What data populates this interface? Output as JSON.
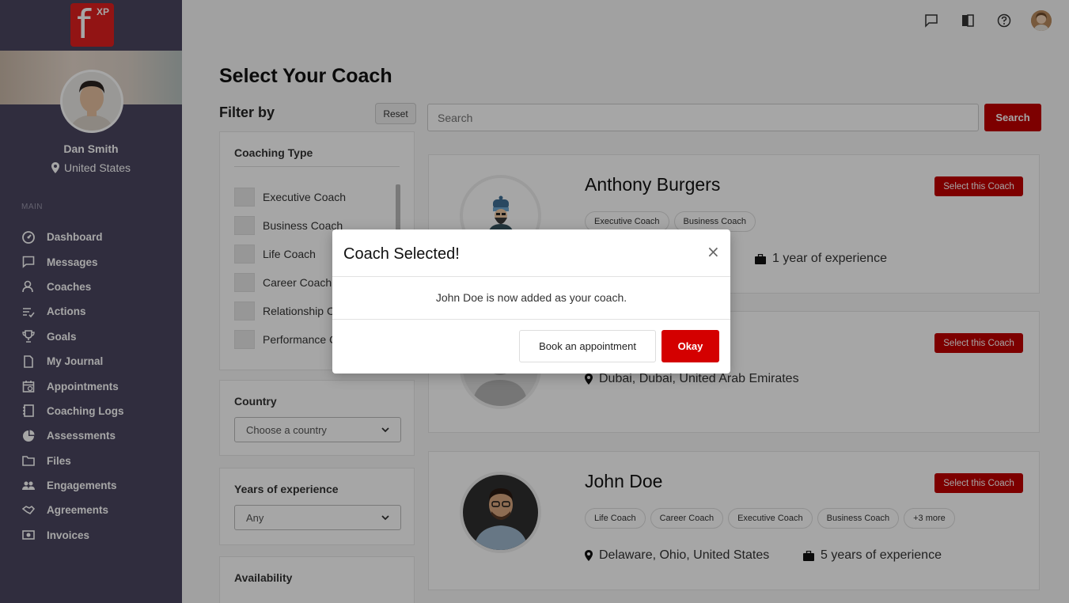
{
  "logo": {
    "letter": "f",
    "superscript": "XP"
  },
  "user": {
    "name": "Dan Smith",
    "location": "United States"
  },
  "sidebar": {
    "section_label": "MAIN",
    "items": [
      {
        "label": "Dashboard",
        "icon": "dashboard-icon"
      },
      {
        "label": "Messages",
        "icon": "message-icon"
      },
      {
        "label": "Coaches",
        "icon": "coaches-icon"
      },
      {
        "label": "Actions",
        "icon": "actions-icon"
      },
      {
        "label": "Goals",
        "icon": "trophy-icon"
      },
      {
        "label": "My Journal",
        "icon": "journal-icon"
      },
      {
        "label": "Appointments",
        "icon": "calendar-icon"
      },
      {
        "label": "Coaching Logs",
        "icon": "notebook-icon"
      },
      {
        "label": "Assessments",
        "icon": "pie-chart-icon"
      },
      {
        "label": "Files",
        "icon": "folder-icon"
      },
      {
        "label": "Engagements",
        "icon": "users-icon"
      },
      {
        "label": "Agreements",
        "icon": "handshake-icon"
      },
      {
        "label": "Invoices",
        "icon": "invoice-icon"
      }
    ]
  },
  "page": {
    "title": "Select Your Coach"
  },
  "filter": {
    "title": "Filter by",
    "reset_label": "Reset",
    "coaching_type": {
      "title": "Coaching Type",
      "options": [
        "Executive Coach",
        "Business Coach",
        "Life Coach",
        "Career Coach",
        "Relationship Coach",
        "Performance Coach"
      ]
    },
    "country": {
      "title": "Country",
      "placeholder": "Choose a country"
    },
    "years": {
      "title": "Years of experience",
      "value": "Any"
    },
    "availability": {
      "title": "Availability"
    }
  },
  "search": {
    "placeholder": "Search",
    "button_label": "Search"
  },
  "coaches": [
    {
      "name": "Anthony Burgers",
      "tags": [
        "Executive Coach",
        "Business Coach"
      ],
      "location": "",
      "experience": "1 year of experience",
      "select_label": "Select this Coach"
    },
    {
      "name": "",
      "tags": [],
      "location": "Dubai, Dubai, United Arab Emirates",
      "experience": "",
      "select_label": "Select this Coach"
    },
    {
      "name": "John Doe",
      "tags": [
        "Life Coach",
        "Career Coach",
        "Executive Coach",
        "Business Coach",
        "+3 more"
      ],
      "location": "Delaware, Ohio, United States",
      "experience": "5 years of experience",
      "select_label": "Select this Coach"
    }
  ],
  "modal": {
    "title": "Coach Selected!",
    "close": "×",
    "message": "John Doe is now added as your coach.",
    "book_label": "Book an appointment",
    "okay_label": "Okay"
  },
  "colors": {
    "sidebar": "#4a4560",
    "accent": "#c00000",
    "logo": "#e02020"
  }
}
